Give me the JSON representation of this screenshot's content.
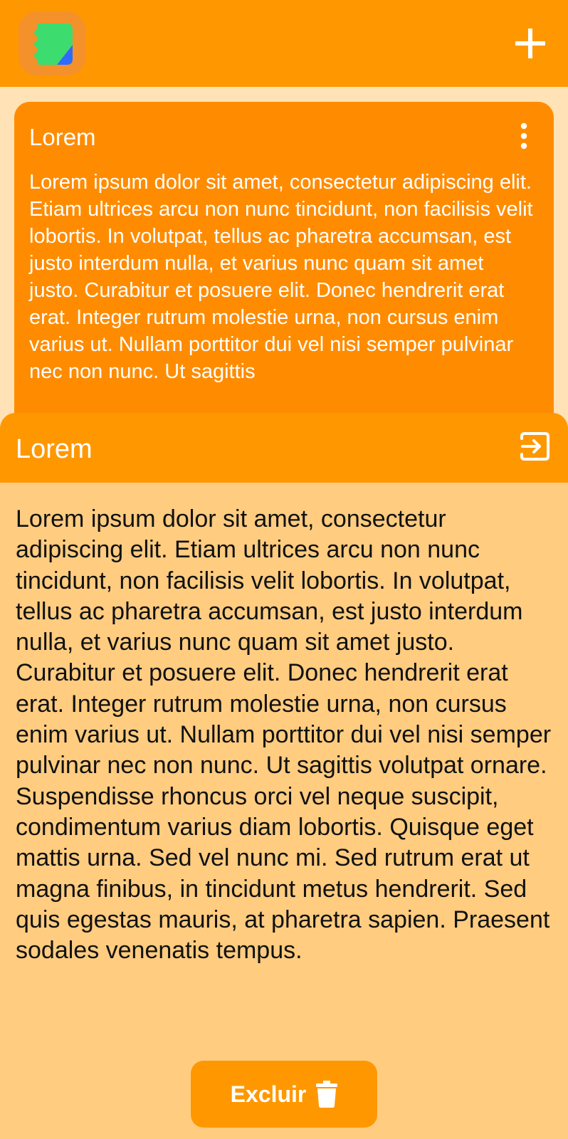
{
  "app_bar": {
    "logo_icon": "sticky-note-icon",
    "add_icon": "plus-icon"
  },
  "note_card": {
    "title": "Lorem",
    "body": "Lorem ipsum dolor sit amet, consectetur adipiscing elit. Etiam ultrices arcu non nunc tincidunt, non facilisis velit lobortis. In volutpat, tellus ac pharetra accumsan, est justo interdum nulla, et varius nunc quam sit amet justo. Curabitur et posuere elit. Donec hendrerit erat erat. Integer rutrum molestie urna, non cursus enim varius ut. Nullam porttitor dui vel nisi semper pulvinar nec non nunc. Ut sagittis",
    "menu_icon": "more-vertical-icon"
  },
  "sheet": {
    "title": "Lorem",
    "open_icon": "enter-icon",
    "body": "Lorem ipsum dolor sit amet, consectetur adipiscing elit. Etiam ultrices arcu non nunc tincidunt, non facilisis velit lobortis. In volutpat, tellus ac pharetra accumsan, est justo interdum nulla, et varius nunc quam sit amet justo. Curabitur et posuere elit. Donec hendrerit erat erat. Integer rutrum molestie urna, non cursus enim varius ut. Nullam porttitor dui vel nisi semper pulvinar nec non nunc. Ut sagittis volutpat ornare. Suspendisse rhoncus orci vel neque suscipit, condimentum varius diam lobortis. Quisque eget mattis urna. Sed vel nunc mi. Sed rutrum erat ut magna finibus, in tincidunt metus hendrerit. Sed quis egestas mauris, at pharetra sapien. Praesent sodales venenatis tempus.",
    "delete_label": "Excluir",
    "delete_icon": "trash-icon"
  },
  "colors": {
    "primary": "#FF9800",
    "card": "#FF8C00",
    "background": "#FFE2B5",
    "sheet": "#FFCC80"
  }
}
